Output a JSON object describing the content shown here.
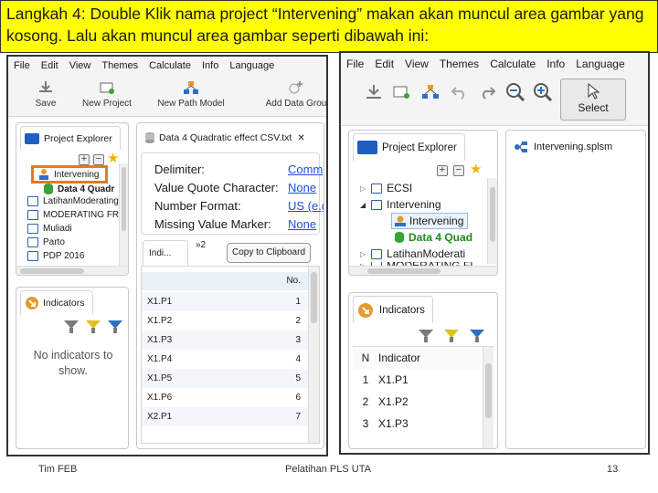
{
  "slide": {
    "headline": "Langkah 4: Double Klik nama project “Intervening” makan akan muncul area gambar yang kosong. Lalu akan muncul area gambar seperti dibawah ini:",
    "footer_left": "Tim FEB",
    "footer_center": "Pelatihan PLS UTA",
    "footer_right": "13"
  },
  "left": {
    "menu": [
      "File",
      "Edit",
      "View",
      "Themes",
      "Calculate",
      "Info",
      "Language"
    ],
    "toolbar": {
      "save": "Save",
      "new_project": "New Project",
      "new_path_model": "New Path Model",
      "add_data_group": "Add Data Grou"
    },
    "project_explorer": {
      "title": "Project Explorer",
      "items": [
        "Intervening",
        "Data 4 Quadr",
        "LatihanModerating",
        "MODERATING FR",
        "Muliadi",
        "Parto",
        "PDP 2016"
      ]
    },
    "data_tab": "Data 4 Quadratic effect CSV.txt",
    "settings": {
      "delimiter_label": "Delimiter:",
      "delimiter_value": "Comm",
      "quote_label": "Value Quote Character:",
      "quote_value": "None",
      "number_label": "Number Format:",
      "number_value": "US (e.g",
      "missing_label": "Missing Value Marker:",
      "missing_value": "None"
    },
    "indicator_tab": "Indi...",
    "tab_overflow": "»2",
    "copy_button": "Copy to Clipboard",
    "table_header": "No.",
    "rows": [
      {
        "name": "X1.P1",
        "no": "1"
      },
      {
        "name": "X1.P2",
        "no": "2"
      },
      {
        "name": "X1.P3",
        "no": "3"
      },
      {
        "name": "X1.P4",
        "no": "4"
      },
      {
        "name": "X1.P5",
        "no": "5"
      },
      {
        "name": "X1.P6",
        "no": "6"
      },
      {
        "name": "X2.P1",
        "no": "7"
      }
    ],
    "indicators": {
      "title": "Indicators",
      "empty": "No indicators to show."
    }
  },
  "right": {
    "menu": [
      "File",
      "Edit",
      "View",
      "Themes",
      "Calculate",
      "Info",
      "Language"
    ],
    "select_label": "Select",
    "project_explorer": {
      "title": "Project Explorer",
      "items": [
        "ECSI",
        "Intervening",
        "Intervening",
        "Data 4 Quad",
        "LatihanModerati",
        "MODERATING FI"
      ]
    },
    "model_tab": "Intervening.splsm",
    "indicators": {
      "title": "Indicators",
      "col_n": "N",
      "col_indicator": "Indicator",
      "rows": [
        {
          "n": "1",
          "name": "X1.P1"
        },
        {
          "n": "2",
          "name": "X1.P2"
        },
        {
          "n": "3",
          "name": "X1.P3"
        }
      ]
    }
  },
  "colors": {
    "highlight_box": "#e07b22",
    "headline_bg": "#ffff00",
    "folder_blue": "#1f5fbf",
    "link_blue": "#1a4fd6"
  }
}
